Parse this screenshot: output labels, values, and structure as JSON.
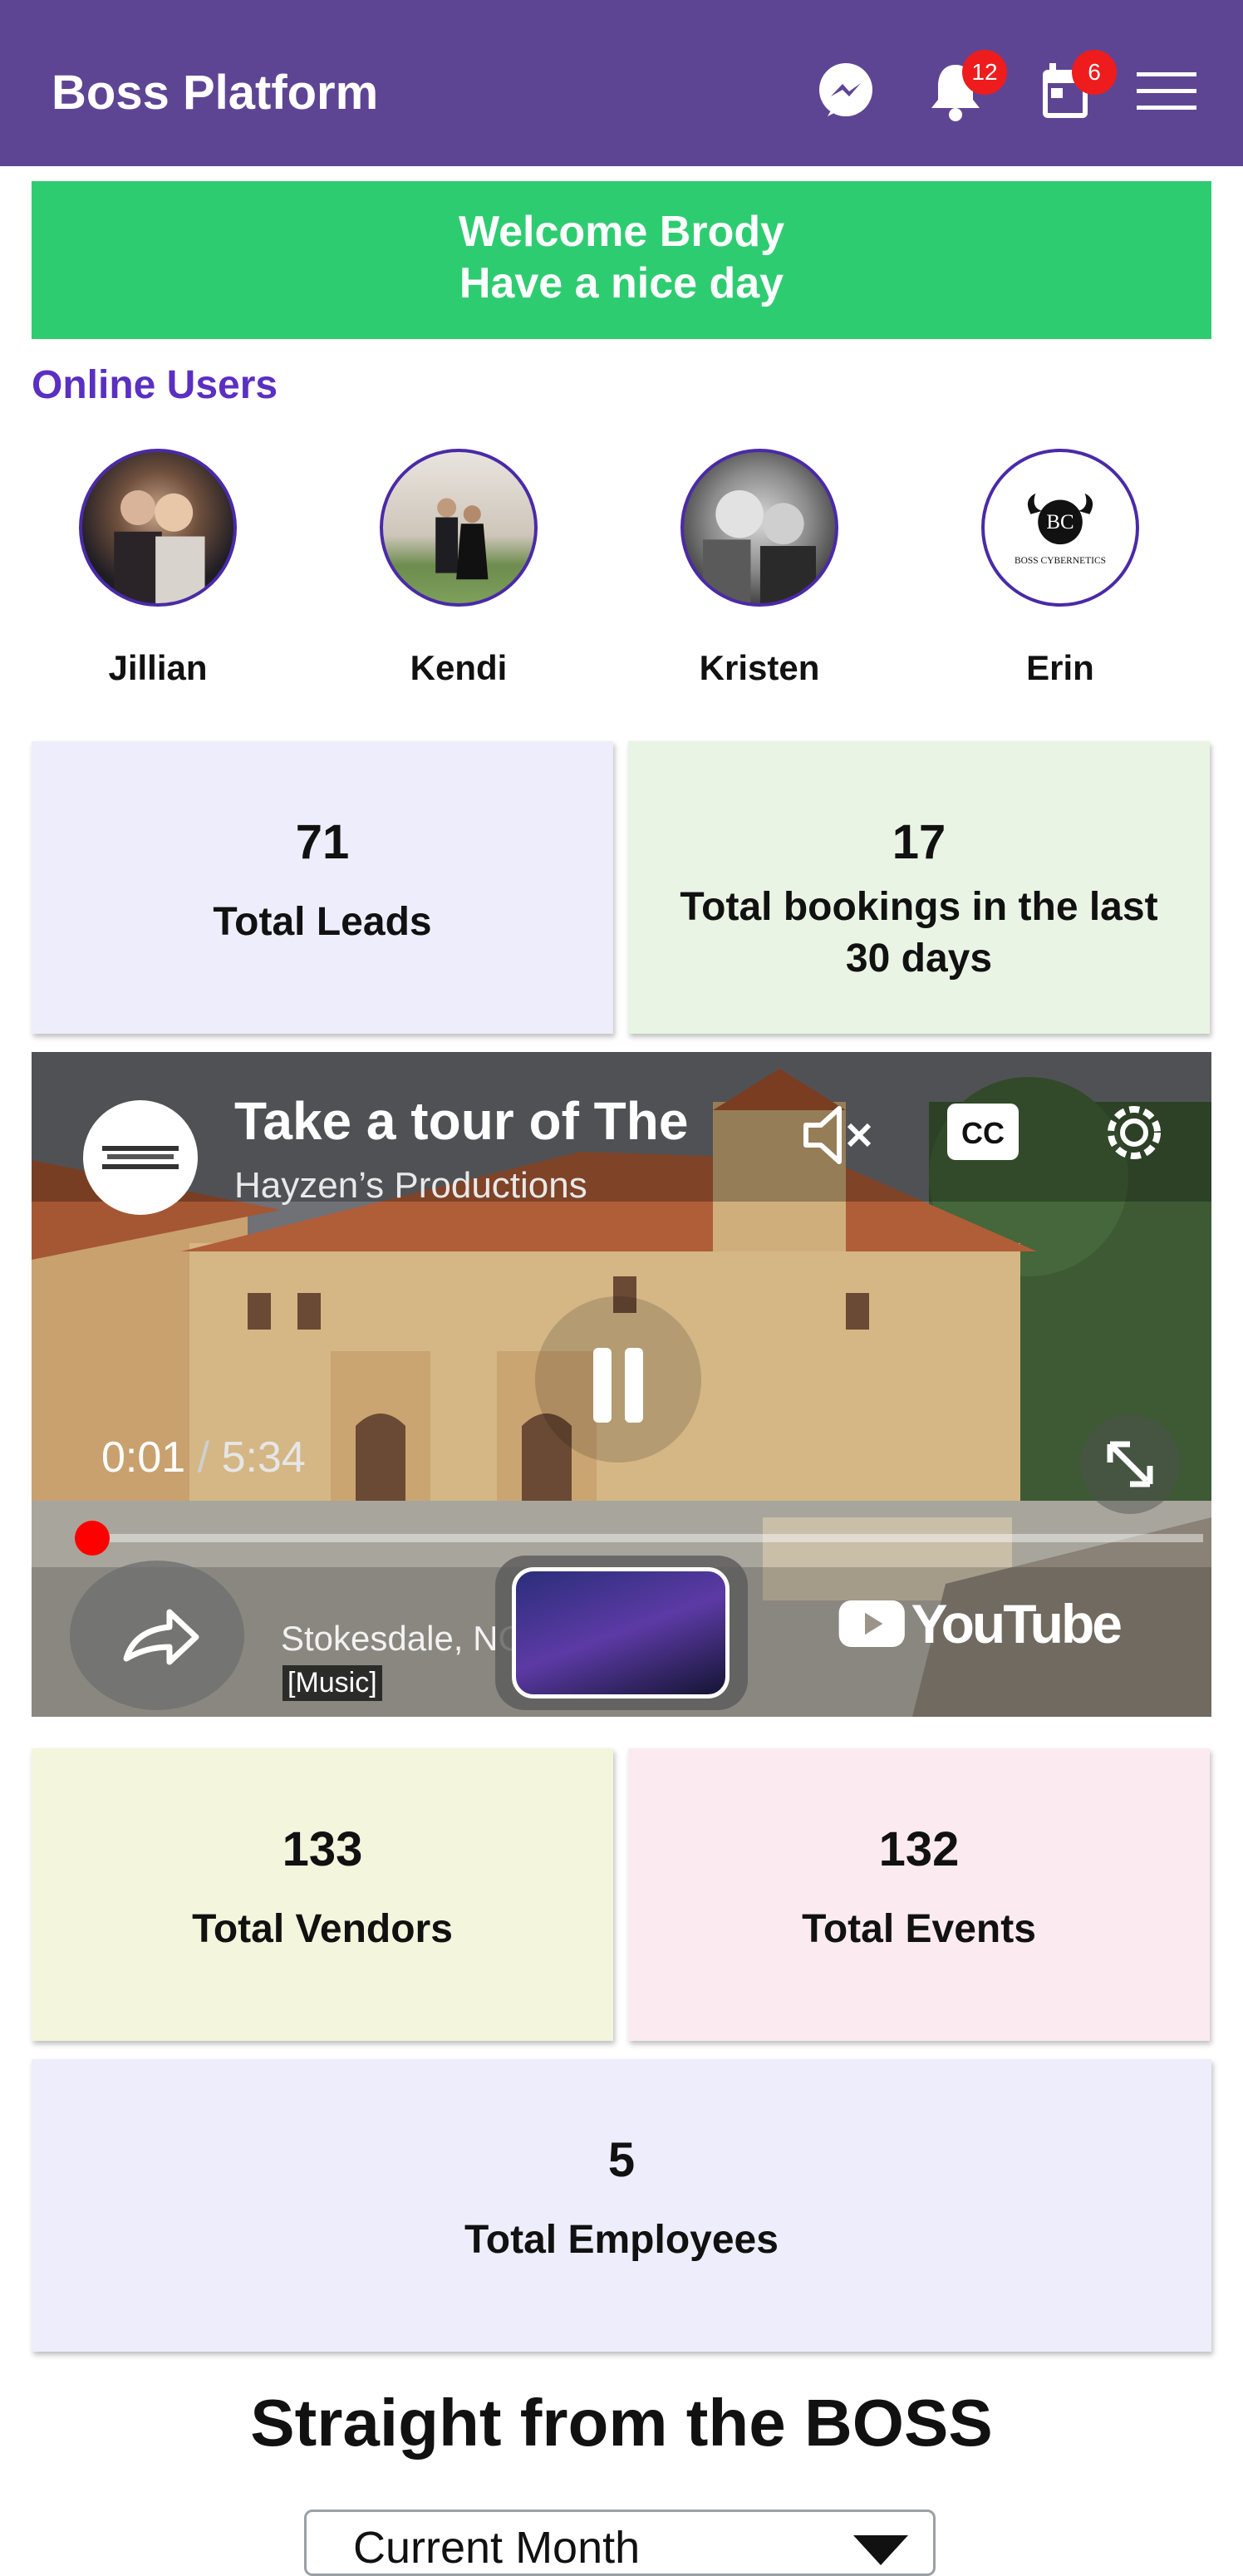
{
  "header": {
    "title": "Boss Platform",
    "icons": [
      "messenger-icon",
      "bell-icon",
      "calendar-icon",
      "menu-icon"
    ],
    "notifications_count": "12",
    "calendar_count": "6"
  },
  "welcome": {
    "line1": "Welcome Brody",
    "line2": "Have a nice day"
  },
  "online_users": {
    "title": "Online Users",
    "users": [
      {
        "name": "Jillian"
      },
      {
        "name": "Kendi"
      },
      {
        "name": "Kristen"
      },
      {
        "name": "Erin",
        "logo_text": "BOSS CYBERNETICS"
      }
    ]
  },
  "stats": {
    "leads": {
      "value": "71",
      "label": "Total Leads"
    },
    "bookings": {
      "value": "17",
      "label": "Total bookings in the last 30 days"
    },
    "vendors": {
      "value": "133",
      "label": "Total Vendors"
    },
    "events": {
      "value": "132",
      "label": "Total Events"
    },
    "employees": {
      "value": "5",
      "label": "Total Employees"
    }
  },
  "video": {
    "title": "Take a tour of The",
    "channel": "Hayzen’s Productions",
    "time_current": "0:01",
    "time_total": "5:34",
    "progress": 0.003,
    "location_text": "Stokesdale, NC",
    "caption": "[Music]",
    "platform": "YouTube"
  },
  "boss_section": {
    "title": "Straight from the BOSS",
    "period_select": "Current Month"
  },
  "colors": {
    "header_bg": "#5e4594",
    "welcome_bg": "#2ecc71",
    "online_title": "#5a2fc2",
    "card_leads": "#eeedfb",
    "card_bookings": "#e9f4e4",
    "card_vendors": "#f3f6dc",
    "card_events": "#fbebf1",
    "card_employees": "#eeedfb"
  }
}
